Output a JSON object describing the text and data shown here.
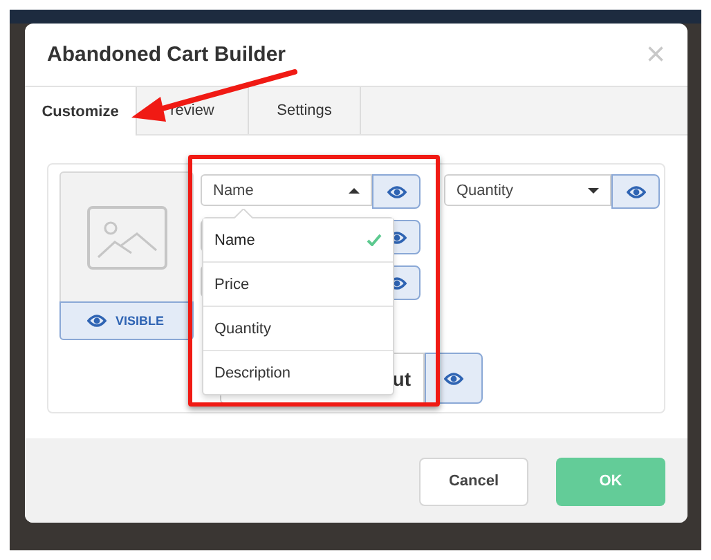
{
  "window": {
    "title": "Abandoned Cart Builder",
    "close": "×"
  },
  "tabs": [
    {
      "label": "Customize",
      "selected": true
    },
    {
      "label": "review",
      "selected": false
    },
    {
      "label": "Settings",
      "selected": false
    }
  ],
  "image_card": {
    "button": "VISIBLE"
  },
  "column_2": [
    {
      "kind": "select",
      "value": "Name",
      "expanded": true
    },
    {
      "kind": "select"
    },
    {
      "kind": "select"
    },
    {
      "kind": "button",
      "label": "ut"
    }
  ],
  "column_3": [
    {
      "kind": "select",
      "value": "Quantity",
      "expanded": false
    }
  ],
  "dropdown": {
    "options": [
      {
        "label": "Name",
        "selected": true
      },
      {
        "label": "Price",
        "selected": false
      },
      {
        "label": "Quantity",
        "selected": false
      },
      {
        "label": "Description",
        "selected": false
      }
    ]
  },
  "buttons": [
    {
      "label": "Cancel",
      "kind": "secondary"
    },
    {
      "label": "OK",
      "kind": "primary"
    }
  ],
  "annotations": {
    "arrow": true,
    "highlight_box": true
  }
}
